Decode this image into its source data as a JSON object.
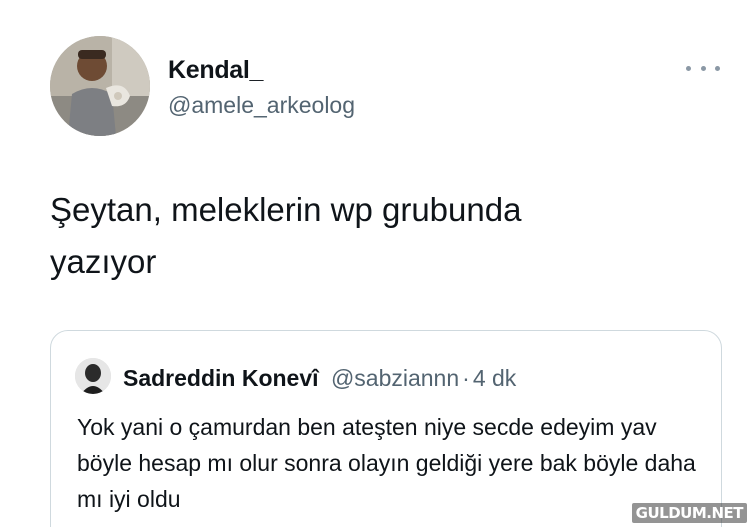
{
  "tweet": {
    "author": {
      "display_name": "Kendal_",
      "handle": "@amele_arkeolog"
    },
    "more_icon": "more-dots-icon",
    "text": "Şeytan, meleklerin wp grubunda\nyazıyor"
  },
  "quoted_tweet": {
    "author": {
      "display_name": "Sadreddin Konevî",
      "handle": "@sabziannn",
      "separator": "·",
      "time": "4 dk"
    },
    "text": "Yok yani o çamurdan ben ateşten niye secde edeyim yav böyle hesap mı olur sonra olayın geldiği yere bak böyle daha mı iyi oldu"
  },
  "watermark": {
    "text": "GULDUM.NET"
  },
  "colors": {
    "primary_text": "#0f1419",
    "secondary_text": "#536471",
    "border": "#cfd9de",
    "background": "#ffffff"
  }
}
